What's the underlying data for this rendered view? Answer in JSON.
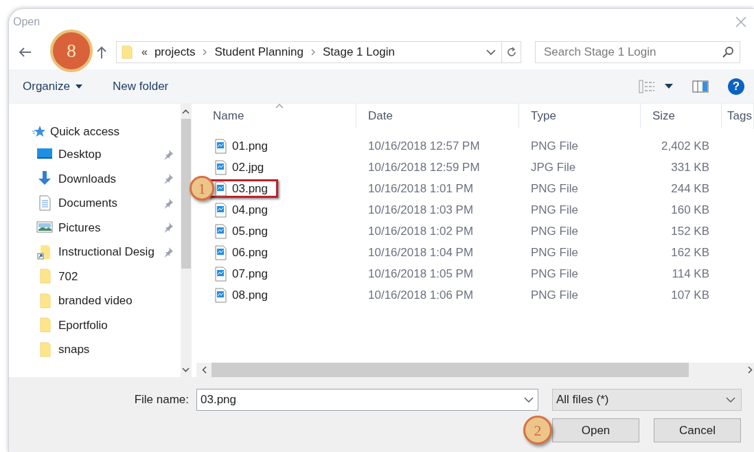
{
  "window": {
    "title": "Open"
  },
  "navigation": {
    "path": [
      "projects",
      "Student Planning",
      "Stage 1 Login"
    ],
    "overflow": "«",
    "search": {
      "placeholder": "Search Stage 1 Login"
    },
    "callout": {
      "label": "8",
      "kind": "filled"
    }
  },
  "toolbar": {
    "organize": "Organize",
    "new_folder": "New folder",
    "help": "?"
  },
  "sidebar": {
    "header": "Quick access",
    "items": [
      {
        "label": "Desktop",
        "kind": "desktop",
        "pinned": true
      },
      {
        "label": "Downloads",
        "kind": "downloads",
        "pinned": true
      },
      {
        "label": "Documents",
        "kind": "documents",
        "pinned": true
      },
      {
        "label": "Pictures",
        "kind": "pictures",
        "pinned": true
      },
      {
        "label": "Instructional Desig",
        "kind": "shortcut",
        "pinned": true
      },
      {
        "label": "702",
        "kind": "folder",
        "pinned": false
      },
      {
        "label": "branded video",
        "kind": "folder",
        "pinned": false
      },
      {
        "label": "Eportfolio",
        "kind": "folder",
        "pinned": false
      },
      {
        "label": "snaps",
        "kind": "folder",
        "pinned": false
      }
    ]
  },
  "table": {
    "columns": [
      "Name",
      "Date",
      "Type",
      "Size",
      "Tags"
    ],
    "rows": [
      {
        "name": "01.png",
        "date": "10/16/2018 12:57 PM",
        "type": "PNG File",
        "size": "2,402 KB",
        "highlighted": false
      },
      {
        "name": "02.jpg",
        "date": "10/16/2018 12:59 PM",
        "type": "JPG File",
        "size": "331 KB",
        "highlighted": false
      },
      {
        "name": "03.png",
        "date": "10/16/2018 1:01 PM",
        "type": "PNG File",
        "size": "244 KB",
        "highlighted": true,
        "callout": {
          "label": "1",
          "kind": "outline"
        }
      },
      {
        "name": "04.png",
        "date": "10/16/2018 1:03 PM",
        "type": "PNG File",
        "size": "160 KB",
        "highlighted": false
      },
      {
        "name": "05.png",
        "date": "10/16/2018 1:02 PM",
        "type": "PNG File",
        "size": "152 KB",
        "highlighted": false
      },
      {
        "name": "06.png",
        "date": "10/16/2018 1:04 PM",
        "type": "PNG File",
        "size": "162 KB",
        "highlighted": false
      },
      {
        "name": "07.png",
        "date": "10/16/2018 1:05 PM",
        "type": "PNG File",
        "size": "114 KB",
        "highlighted": false
      },
      {
        "name": "08.png",
        "date": "10/16/2018 1:06 PM",
        "type": "PNG File",
        "size": "107 KB",
        "highlighted": false
      }
    ]
  },
  "footer": {
    "file_name_label": "File name:",
    "file_name": "03.png",
    "filter": "All files (*)",
    "open_button": {
      "label": "Open",
      "callout": {
        "label": "2",
        "kind": "outline"
      }
    },
    "cancel_button": "Cancel"
  }
}
